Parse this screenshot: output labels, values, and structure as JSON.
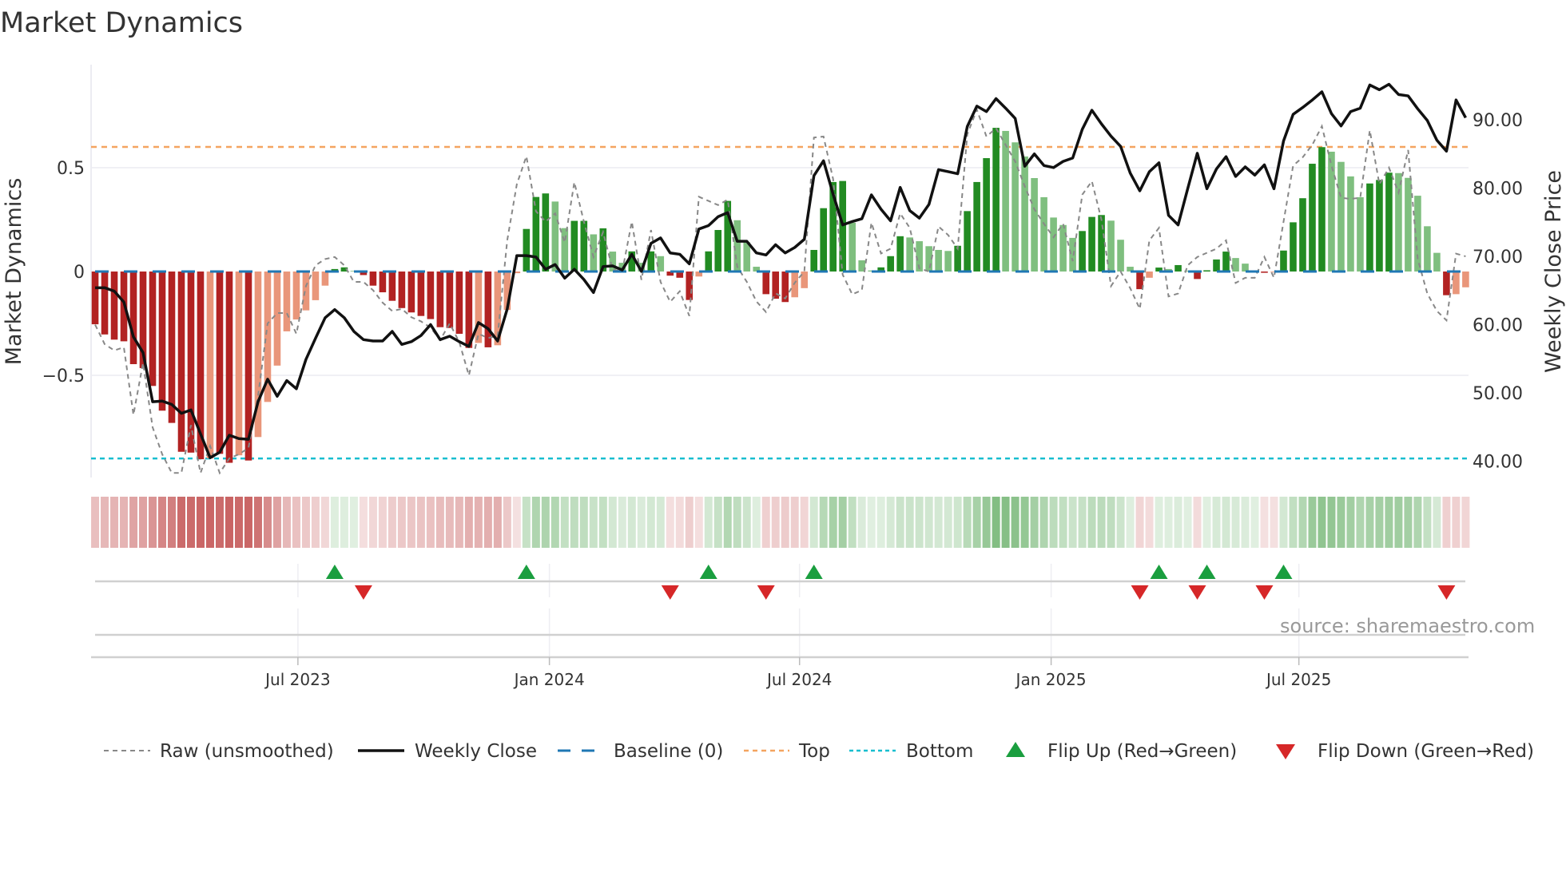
{
  "chart_data": {
    "type": "bar",
    "title": "Market Dynamics",
    "ylabel": "Market Dynamics",
    "ylabel_right": "Weekly Close Price",
    "x_unit": "week index",
    "xlim": [
      0.58,
      144.3
    ],
    "ylim": [
      -0.992,
      0.996
    ],
    "ylim_right": [
      37.6,
      98.07
    ],
    "yticks": [
      {
        "value": 0.5,
        "label": "0.5"
      },
      {
        "value": 0,
        "label": "0"
      },
      {
        "value": -0.5,
        "label": "−0.5"
      }
    ],
    "yticks_right": [
      {
        "value": 90,
        "label": "90.00"
      },
      {
        "value": 80,
        "label": "80.00"
      },
      {
        "value": 70,
        "label": "70.00"
      },
      {
        "value": 60,
        "label": "60.00"
      },
      {
        "value": 50,
        "label": "50.00"
      },
      {
        "value": 40,
        "label": "40.00"
      }
    ],
    "xticks": [
      {
        "value": 22.16,
        "label": "Jul 2023"
      },
      {
        "value": 48.4,
        "label": "Jan 2024"
      },
      {
        "value": 74.5,
        "label": "Jul 2024"
      },
      {
        "value": 100.75,
        "label": "Jan 2025"
      },
      {
        "value": 126.6,
        "label": "Jul 2025"
      }
    ],
    "top_level": 0.6,
    "bottom_level": -0.9,
    "baseline": 0,
    "values": [
      -0.254,
      -0.303,
      -0.328,
      -0.336,
      -0.446,
      -0.465,
      -0.551,
      -0.67,
      -0.729,
      -0.868,
      -0.872,
      -0.904,
      -0.9,
      -0.878,
      -0.921,
      -0.885,
      -0.91,
      -0.797,
      -0.628,
      -0.453,
      -0.288,
      -0.231,
      -0.187,
      -0.138,
      -0.068,
      0.012,
      0.02,
      0.003,
      -0.017,
      -0.068,
      -0.1,
      -0.141,
      -0.176,
      -0.197,
      -0.214,
      -0.229,
      -0.268,
      -0.272,
      -0.3,
      -0.368,
      -0.344,
      -0.365,
      -0.355,
      -0.185,
      -0.008,
      0.205,
      0.359,
      0.376,
      0.337,
      0.209,
      0.244,
      0.244,
      0.179,
      0.208,
      0.096,
      0.042,
      0.097,
      0.042,
      0.097,
      0.074,
      -0.02,
      -0.03,
      -0.137,
      -0.024,
      0.097,
      0.2,
      0.34,
      0.247,
      0.141,
      0.023,
      -0.109,
      -0.131,
      -0.147,
      -0.124,
      -0.08,
      0.104,
      0.305,
      0.431,
      0.436,
      0.235,
      0.054,
      0.005,
      0.02,
      0.074,
      0.17,
      0.164,
      0.146,
      0.122,
      0.104,
      0.099,
      0.124,
      0.291,
      0.431,
      0.546,
      0.692,
      0.677,
      0.622,
      0.554,
      0.45,
      0.358,
      0.26,
      0.224,
      0.162,
      0.195,
      0.263,
      0.272,
      0.245,
      0.153,
      0.023,
      -0.085,
      -0.03,
      0.019,
      0.012,
      0.031,
      0.004,
      -0.036,
      0.006,
      0.058,
      0.096,
      0.065,
      0.038,
      0.003,
      -0.006,
      -0.003,
      0.101,
      0.237,
      0.353,
      0.519,
      0.599,
      0.577,
      0.528,
      0.458,
      0.358,
      0.424,
      0.441,
      0.476,
      0.474,
      0.451,
      0.365,
      0.218,
      0.09,
      -0.114,
      -0.109,
      -0.076
    ],
    "strong": [
      1,
      1,
      1,
      1,
      1,
      1,
      1,
      1,
      1,
      1,
      1,
      1,
      0,
      1,
      1,
      0,
      1,
      0,
      0,
      0,
      0,
      0,
      0,
      0,
      0,
      1,
      1,
      0,
      1,
      1,
      1,
      1,
      1,
      1,
      1,
      1,
      1,
      1,
      1,
      1,
      0,
      1,
      0,
      0,
      0,
      1,
      1,
      1,
      0,
      0,
      1,
      1,
      0,
      1,
      0,
      0,
      1,
      0,
      1,
      0,
      1,
      1,
      1,
      0,
      1,
      1,
      1,
      0,
      0,
      0,
      1,
      1,
      1,
      0,
      0,
      1,
      1,
      1,
      1,
      0,
      0,
      0,
      1,
      1,
      1,
      0,
      0,
      0,
      0,
      0,
      1,
      1,
      1,
      1,
      1,
      0,
      0,
      0,
      0,
      0,
      0,
      0,
      0,
      1,
      1,
      1,
      0,
      0,
      0,
      1,
      0,
      1,
      0,
      1,
      0,
      1,
      1,
      1,
      1,
      0,
      0,
      0,
      1,
      0,
      1,
      1,
      1,
      1,
      1,
      0,
      0,
      0,
      0,
      1,
      1,
      1,
      0,
      0,
      0,
      0,
      0,
      1,
      0,
      0
    ],
    "raw": [
      -0.256,
      -0.35,
      -0.38,
      -0.365,
      -0.69,
      -0.44,
      -0.75,
      -0.88,
      -0.97,
      -0.97,
      -0.74,
      -0.97,
      -0.84,
      -0.97,
      -0.9,
      -0.88,
      -0.85,
      -0.6,
      -0.25,
      -0.2,
      -0.2,
      -0.3,
      -0.07,
      0.03,
      0.06,
      0.07,
      0.03,
      -0.05,
      -0.05,
      -0.09,
      -0.15,
      -0.19,
      -0.18,
      -0.22,
      -0.24,
      -0.27,
      -0.33,
      -0.25,
      -0.34,
      -0.5,
      -0.3,
      -0.32,
      -0.31,
      0.15,
      0.42,
      0.555,
      0.29,
      0.24,
      0.28,
      0.14,
      0.43,
      0.24,
      0.07,
      0.19,
      0.01,
      0.0,
      0.24,
      -0.04,
      0.2,
      -0.05,
      -0.146,
      -0.095,
      -0.214,
      0.36,
      0.34,
      0.32,
      0.346,
      0.023,
      -0.05,
      -0.144,
      -0.195,
      -0.105,
      -0.13,
      -0.054,
      0.0,
      0.645,
      0.65,
      0.446,
      -0.015,
      -0.11,
      -0.09,
      0.235,
      0.087,
      0.11,
      0.28,
      0.21,
      0.015,
      0.0,
      0.217,
      0.176,
      0.11,
      0.66,
      0.78,
      0.65,
      0.69,
      0.61,
      0.53,
      0.41,
      0.3,
      0.23,
      0.165,
      0.23,
      0.05,
      0.37,
      0.435,
      0.25,
      -0.07,
      0.0,
      -0.08,
      -0.18,
      0.15,
      0.21,
      -0.12,
      -0.106,
      0.03,
      0.07,
      0.09,
      0.11,
      0.15,
      -0.055,
      -0.03,
      -0.03,
      0.07,
      -0.03,
      0.24,
      0.51,
      0.55,
      0.61,
      0.7,
      0.51,
      0.355,
      0.35,
      0.355,
      0.68,
      0.42,
      0.5,
      0.38,
      0.585,
      0.06,
      -0.106,
      -0.19,
      -0.235,
      0.086,
      0.073
    ],
    "close": [
      65.4,
      65.4,
      64.9,
      63.3,
      58.2,
      55.9,
      48.7,
      48.8,
      48.3,
      47.0,
      47.5,
      44.0,
      40.5,
      41.3,
      43.8,
      43.3,
      43.2,
      48.7,
      52.0,
      49.5,
      51.8,
      50.6,
      54.9,
      58.0,
      61.0,
      62.2,
      61.0,
      59.0,
      57.8,
      57.6,
      57.6,
      59.0,
      57.1,
      57.5,
      58.4,
      60.0,
      57.8,
      58.3,
      57.5,
      56.8,
      60.3,
      59.4,
      57.6,
      62.3,
      70.1,
      70.1,
      69.9,
      68.1,
      68.8,
      66.8,
      68.1,
      66.6,
      64.7,
      68.5,
      68.6,
      68.0,
      70.3,
      67.8,
      71.9,
      72.7,
      70.5,
      70.3,
      68.9,
      74.0,
      74.5,
      75.8,
      76.4,
      72.2,
      72.2,
      70.5,
      70.2,
      71.7,
      70.5,
      71.3,
      72.5,
      81.8,
      84.0,
      79.1,
      74.6,
      75.1,
      75.5,
      79.0,
      76.9,
      75.2,
      80.1,
      76.7,
      75.6,
      77.6,
      82.7,
      82.4,
      82.1,
      89.0,
      92.0,
      91.2,
      93.1,
      91.7,
      90.2,
      83.2,
      85.0,
      83.3,
      83.0,
      83.9,
      84.4,
      88.6,
      91.4,
      89.4,
      87.6,
      86.1,
      82.2,
      79.6,
      82.4,
      83.7,
      76.0,
      74.6,
      79.9,
      85.1,
      79.9,
      82.8,
      84.6,
      81.7,
      83.1,
      81.9,
      83.4,
      79.9,
      86.9,
      90.8,
      91.8,
      92.9,
      94.1,
      90.9,
      89.1,
      91.2,
      91.7,
      95.1,
      94.4,
      95.2,
      93.7,
      93.5,
      91.6,
      89.9,
      87.0,
      85.4,
      92.9,
      90.3
    ],
    "flip_up": [
      26,
      46,
      65,
      76,
      112,
      117,
      125
    ],
    "flip_down": [
      29,
      61,
      71,
      110,
      116,
      123,
      142
    ],
    "legend": {
      "placement": "bottom",
      "items": [
        {
          "label": "Raw (unsmoothed)",
          "kind": "raw"
        },
        {
          "label": "Weekly Close",
          "kind": "close"
        },
        {
          "label": "Baseline (0)",
          "kind": "baseline"
        },
        {
          "label": "Top",
          "kind": "top"
        },
        {
          "label": "Bottom",
          "kind": "bottom"
        },
        {
          "label": "Flip Up (Red→Green)",
          "kind": "up"
        },
        {
          "label": "Flip Down (Green→Red)",
          "kind": "down"
        }
      ]
    },
    "source": "source: sharemaestro.com",
    "colors": {
      "neg_strong": "#b22222",
      "neg_weak": "#e9967a",
      "pos_strong": "#228b22",
      "pos_weak": "#7fbf7f",
      "raw": "#888888",
      "close": "#111111",
      "baseline": "#1f77b4",
      "top": "#f4a460",
      "bottom": "#17becf",
      "up": "#1a9e3f",
      "down": "#d62728"
    }
  }
}
